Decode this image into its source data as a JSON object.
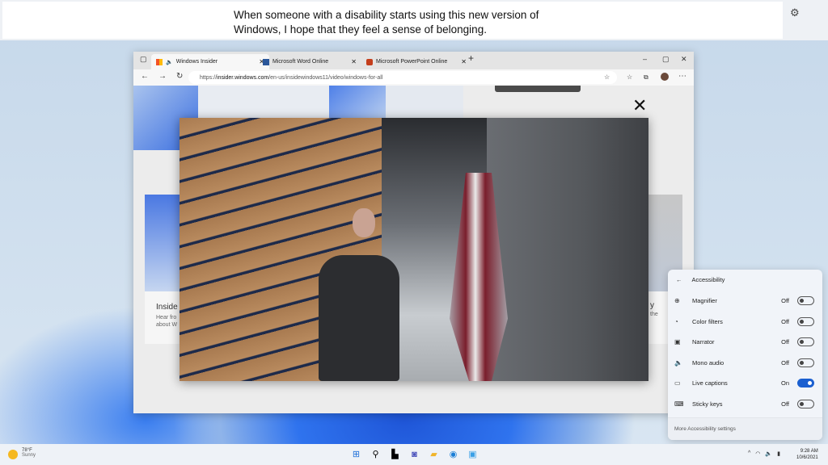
{
  "captions": {
    "text": "When someone with a disability starts using this new version of Windows, I hope that they feel a sense of belonging.",
    "settings_icon": "gear-icon"
  },
  "browser": {
    "tabs": [
      {
        "label": "Windows Insider",
        "active": true,
        "audio": true
      },
      {
        "label": "Microsoft Word Online",
        "active": false
      },
      {
        "label": "Microsoft PowerPoint Online",
        "active": false
      }
    ],
    "new_tab": "+",
    "url_prefix": "https://",
    "url_domain": "insider.windows.com",
    "url_path": "/en-us/insidewindows11/video/windows-for-all",
    "page": {
      "card_title": "Inside",
      "card_line1": "Hear fro",
      "card_line2": "about W",
      "right_card_fragment": "y",
      "right_card_line": "the"
    }
  },
  "video": {
    "close_label": "✕"
  },
  "accessibility": {
    "title": "Accessibility",
    "items": [
      {
        "label": "Magnifier",
        "state": "Off",
        "on": false,
        "icon": "magnifier-icon"
      },
      {
        "label": "Color filters",
        "state": "Off",
        "on": false,
        "icon": "color-filters-icon"
      },
      {
        "label": "Narrator",
        "state": "Off",
        "on": false,
        "icon": "narrator-icon"
      },
      {
        "label": "Mono audio",
        "state": "Off",
        "on": false,
        "icon": "mono-audio-icon"
      },
      {
        "label": "Live captions",
        "state": "On",
        "on": true,
        "icon": "live-captions-icon"
      },
      {
        "label": "Sticky keys",
        "state": "Off",
        "on": false,
        "icon": "sticky-keys-icon"
      }
    ],
    "more": "More Accessibility settings",
    "accent": "#1a5fd0"
  },
  "taskbar": {
    "temp": "78°F",
    "condition": "Sunny",
    "time": "9:28 AM",
    "date": "10/6/2021"
  }
}
